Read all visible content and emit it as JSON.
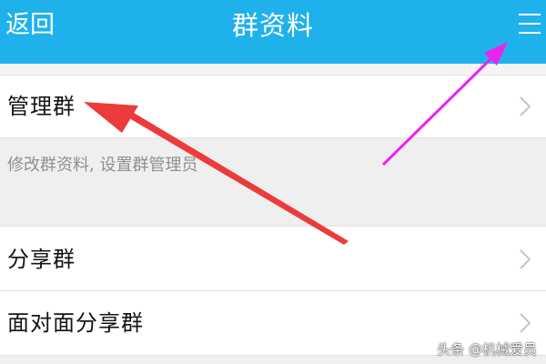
{
  "header": {
    "back_label": "返回",
    "title": "群资料",
    "menu_icon": "hamburger-menu-icon",
    "background_color": "#1fb1ec"
  },
  "rows": [
    {
      "label": "管理群",
      "icon": "chevron-right-icon"
    },
    {
      "label": "分享群",
      "icon": "chevron-right-icon"
    },
    {
      "label": "面对面分享群",
      "icon": "chevron-right-icon"
    }
  ],
  "manage_description": "修改群资料, 设置群管理员",
  "annotations": {
    "red_arrow_color": "#ec3b3b",
    "magenta_arrow_color": "#ee22ee"
  },
  "watermark": "头条 @机械爱员"
}
